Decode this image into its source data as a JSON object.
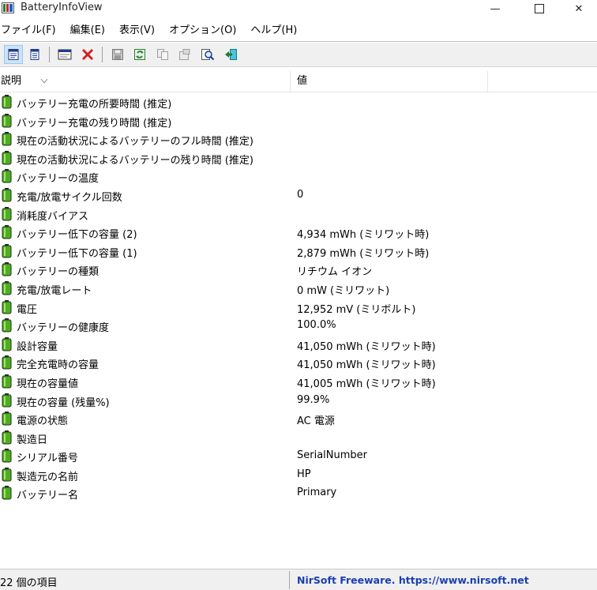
{
  "window": {
    "title": "BatteryInfoView",
    "minimize_glyph": "—",
    "close_glyph": "✕"
  },
  "menu": [
    "ファイル(F)",
    "編集(E)",
    "表示(V)",
    "オプション(O)",
    "ヘルプ(H)"
  ],
  "toolbar": {
    "icons": [
      "properties-icon",
      "battery-log-icon",
      "html-report-icon",
      "delete-icon",
      "save-icon",
      "refresh-icon",
      "copy-icon",
      "options-icon",
      "find-icon",
      "exit-icon"
    ]
  },
  "columns": {
    "description": "説明",
    "value": "値"
  },
  "rows": [
    {
      "label": "バッテリー充電の所要時間 (推定)",
      "value": ""
    },
    {
      "label": "バッテリー充電の残り時間 (推定)",
      "value": ""
    },
    {
      "label": "現在の活動状況によるバッテリーのフル時間 (推定)",
      "value": ""
    },
    {
      "label": "現在の活動状況によるバッテリーの残り時間 (推定)",
      "value": ""
    },
    {
      "label": "バッテリーの温度",
      "value": ""
    },
    {
      "label": "充電/放電サイクル回数",
      "value": "0"
    },
    {
      "label": "消耗度バイアス",
      "value": ""
    },
    {
      "label": "バッテリー低下の容量 (2)",
      "value": "4,934 mWh (ミリワット時)"
    },
    {
      "label": "バッテリー低下の容量 (1)",
      "value": "2,879 mWh (ミリワット時)"
    },
    {
      "label": "バッテリーの種類",
      "value": "リチウム イオン"
    },
    {
      "label": "充電/放電レート",
      "value": "0 mW (ミリワット)"
    },
    {
      "label": "電圧",
      "value": "12,952 mV (ミリボルト)"
    },
    {
      "label": "バッテリーの健康度",
      "value": "100.0%"
    },
    {
      "label": "設計容量",
      "value": "41,050 mWh (ミリワット時)"
    },
    {
      "label": "完全充電時の容量",
      "value": "41,050 mWh (ミリワット時)"
    },
    {
      "label": "現在の容量値",
      "value": "41,005 mWh (ミリワット時)"
    },
    {
      "label": "現在の容量 (残量%)",
      "value": "99.9%"
    },
    {
      "label": "電源の状態",
      "value": "AC 電源"
    },
    {
      "label": "製造日",
      "value": ""
    },
    {
      "label": "シリアル番号",
      "value": "SerialNumber"
    },
    {
      "label": "製造元の名前",
      "value": "HP"
    },
    {
      "label": "バッテリー名",
      "value": "Primary"
    }
  ],
  "status": {
    "item_count": "22 個の項目",
    "credit": "NirSoft Freeware. https://www.nirsoft.net"
  },
  "colors": {
    "battery_green": "#4caf1c",
    "selection_blue": "#cce4f7",
    "link_blue": "#1a3fae"
  }
}
